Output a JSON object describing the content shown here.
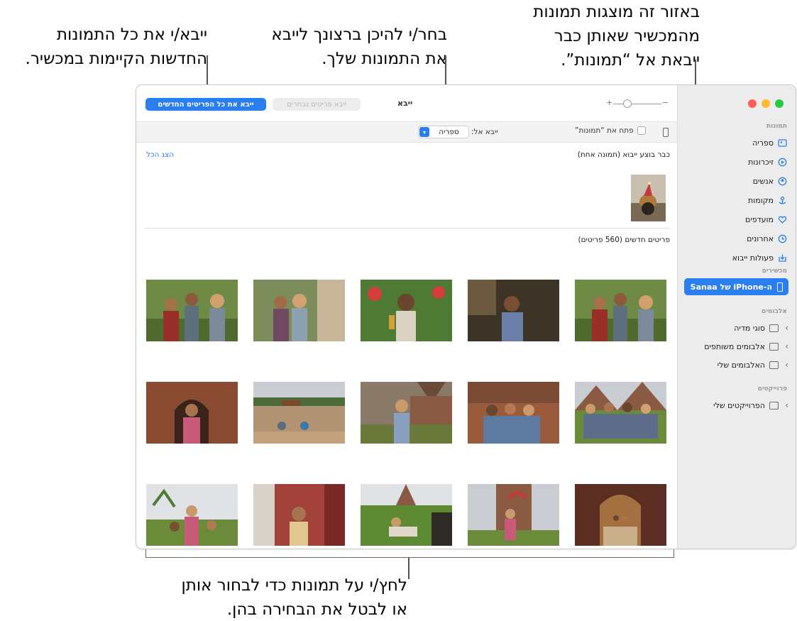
{
  "callouts": {
    "import_all": [
      "ייבא/י את כל התמונות",
      "החדשות הקיימות במכשיר."
    ],
    "choose_dest": [
      "בחר/י להיכן ברצונך לייבא",
      "את התמונות שלך."
    ],
    "already_imported": [
      "באזור זה מוצגות תמונות",
      "מהמכשיר שאותן כבר",
      "ייבאת אל “תמונות”."
    ],
    "click_photos": [
      "לחץ/י על תמונות כדי לבחור אותן",
      "או לבטל את הבחירה בהן."
    ]
  },
  "toolbar": {
    "import_all_button": "ייבא את כל הפריטים החדשים",
    "import_selected_button": "ייבא פריטים נבחרים",
    "title": "ייבא",
    "zoom_plus": "+",
    "zoom_minus": "−",
    "zoom_level": 0.3
  },
  "import_bar": {
    "open_photos_label": "פתח את “תמונות”",
    "import_to_label": "ייבא אל:",
    "destination": "ספריה"
  },
  "content": {
    "already_imported_title": "כבר בוצע ייבוא (תמונה אחת)",
    "show_all": "הצג הכל",
    "new_items_title": "פריטים חדשים (560 פריטים)"
  },
  "sidebar": {
    "photos_section": "תמונות",
    "items": [
      {
        "label": "ספריה",
        "icon": "library-icon"
      },
      {
        "label": "זיכרונות",
        "icon": "memories-icon"
      },
      {
        "label": "אנשים",
        "icon": "people-icon"
      },
      {
        "label": "מקומות",
        "icon": "places-icon"
      },
      {
        "label": "מועדפים",
        "icon": "heart-icon"
      },
      {
        "label": "אחרונים",
        "icon": "clock-icon"
      },
      {
        "label": "פעולות ייבוא",
        "icon": "import-icon"
      }
    ],
    "devices_section": "מכשירים",
    "device": "ה-iPhone של Sanaa",
    "albums_section": "אלבומים",
    "albums": [
      "סוגי מדיה",
      "אלבומים משותפים",
      "האלבומים שלי"
    ],
    "projects_section": "פרוייקטים",
    "projects": [
      "הפרוייקטים שלי"
    ]
  },
  "colors": {
    "accent": "#2a7ef0",
    "close": "#ff5f57",
    "minimize": "#febc2e",
    "zoom": "#28c840"
  }
}
